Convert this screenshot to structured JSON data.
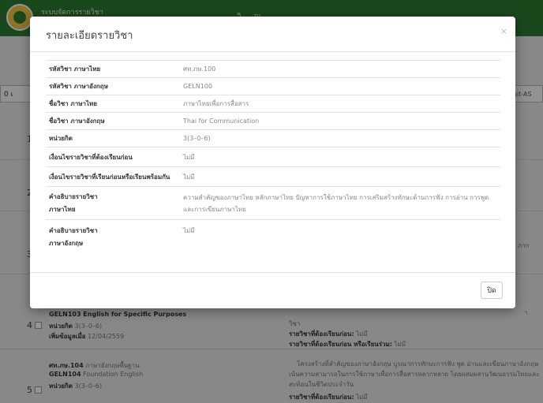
{
  "topbar": {
    "title": "ระบบจัดการรายวิชา",
    "mid_text": "วิ ... ณ"
  },
  "background": {
    "left_cell": "0 เ",
    "right_cell": "auit-AS",
    "rows": [
      {
        "num": "1"
      },
      {
        "num": "2"
      },
      {
        "num": "3"
      },
      {
        "num": "4"
      },
      {
        "num": "5"
      }
    ],
    "side_text": [
      "ภาก",
      "า"
    ],
    "row4": {
      "code_line": "GELN103 English for Specific Purposes",
      "unit_label": "หน่วยกิต",
      "unit_value": "3(3–0–6)",
      "added_label": "เพิ่มข้อมูลเมื่อ",
      "added_value": "12/04/2559",
      "mid_text": "วิชา",
      "prereq_label": "รายวิชาที่ต้องเรียนก่อน:",
      "prereq_value": "ไม่มี",
      "coreq_label": "รายวิชาที่ต้องเรียนก่อน หรือเรียนร่วม:",
      "coreq_value": "ไม่มี"
    },
    "row5": {
      "thai_code": "ศท.ภษ.104",
      "thai_name": "ภาษาอังกฤษพื้นฐาน",
      "eng_code": "GELN104",
      "eng_name": "Foundation English",
      "unit_label": "หน่วยกิต",
      "unit_value": "3(3–0–6)",
      "desc_1": "โครงสร้างที่สำคัญของภาษาอังกฤษ บูรณาการทักษะการฟัง พูด อ่านและเขียนภาษาอังกฤษ",
      "desc_2": "เน้นความสามารถในการใช้ภาษาเพื่อการสื่อสารหลากหลาย โดยผสมผสานวัฒนธรรมไทยและ",
      "desc_3": "สะท้อนในชีวิตประจำวัน",
      "prereq_label": "รายวิชาที่ต้องเรียนก่อน:",
      "prereq_value": "ไม่มี"
    }
  },
  "modal": {
    "title": "รายละเอียดรายวิชา",
    "close_icon": "×",
    "rows": [
      {
        "label": "รหัสวิชา ภาษาไทย",
        "value": "ศท.ภษ.100"
      },
      {
        "label": "รหัสวิชา ภาษาอังกฤษ",
        "value": "GELN100"
      },
      {
        "label": "ชื่อวิชา ภาษาไทย",
        "value": "ภาษาไทยเพื่อการสื่อสาร"
      },
      {
        "label": "ชื่อวิชา ภาษาอังกฤษ",
        "value": "Thai for Communication"
      },
      {
        "label": "หน่วยกิต",
        "value": "3(3–0–6)"
      },
      {
        "label": "เงื่อนไขรายวิชาที่ต้องเรียนก่อน",
        "value": "ไม่มี"
      },
      {
        "label": "เงื่อนไขรายวิชาที่เรียนก่อนหรือเรียนพร้อมกัน",
        "value": "ไม่มี"
      },
      {
        "label_1": "คำอธิบายรายวิชา",
        "label_2": "ภาษาไทย",
        "value": "ความสำคัญของภาษาไทย หลักภาษาไทย ปัญหาการใช้ภาษาไทย การเสริมสร้างทักษะด้านการฟัง การอ่าน การพูดและการเขียนภาษาไทย"
      },
      {
        "label_1": "คำอธิบายรายวิชา",
        "label_2": "ภาษาอังกฤษ",
        "value": "ไม่มี"
      }
    ],
    "close_button": "ปิด"
  }
}
